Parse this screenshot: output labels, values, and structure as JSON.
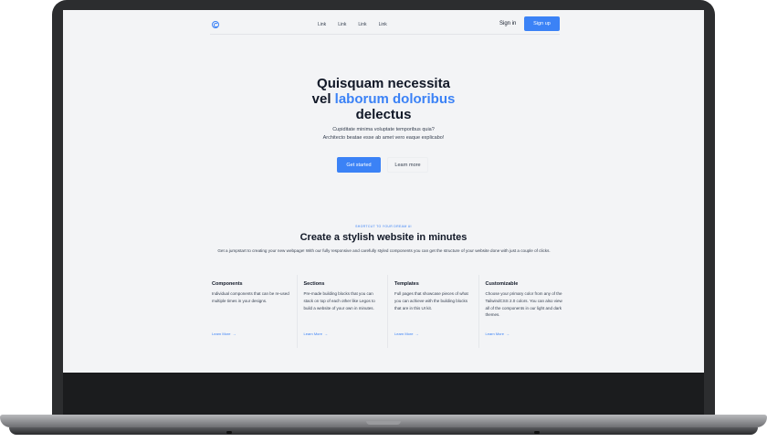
{
  "nav": {
    "links": [
      "Link",
      "Link",
      "Link",
      "Link"
    ],
    "signin": "Sign in",
    "signup": "Sign up"
  },
  "hero": {
    "title_line1": "Quisquam necessita",
    "title_line2_prefix": "vel ",
    "title_line2_accent": "laborum doloribus",
    "title_line3": "delectus",
    "subtitle_line1": "Cupiditate minima voluptate temporibus quia?",
    "subtitle_line2": "Architecto beatae esse ab amet vero eaque explicabo!",
    "primary_button": "Get started",
    "secondary_button": "Learn more"
  },
  "section": {
    "eyebrow": "SHORTCUT TO YOUR DREAM UI",
    "title": "Create a stylish website in minutes",
    "subtitle": "Get a jumpstart to creating your new webpage! With our fully responsive and carefully styled components you can get the structure of your website done with just a couple of clicks."
  },
  "features": [
    {
      "title": "Components",
      "text": "Individual components that can be re-used multiple times in your designs.",
      "link": "Learn More"
    },
    {
      "title": "Sections",
      "text": "Pre-made building blocks that you can stack on top of each other like Legos to build a website of your own in minutes.",
      "link": "Learn More"
    },
    {
      "title": "Templates",
      "text": "Full pages that showcase pieces of what you can achieve with the building blocks that are in this UI kit.",
      "link": "Learn More"
    },
    {
      "title": "Customizable",
      "text": "Choose your primary color from any of the TailwindCSS 2.0 colors. You can also view all of the components in our light and dark themes.",
      "link": "Learn More"
    }
  ],
  "colors": {
    "accent": "#3b82f6",
    "background": "#f3f4f6",
    "text": "#111827"
  }
}
